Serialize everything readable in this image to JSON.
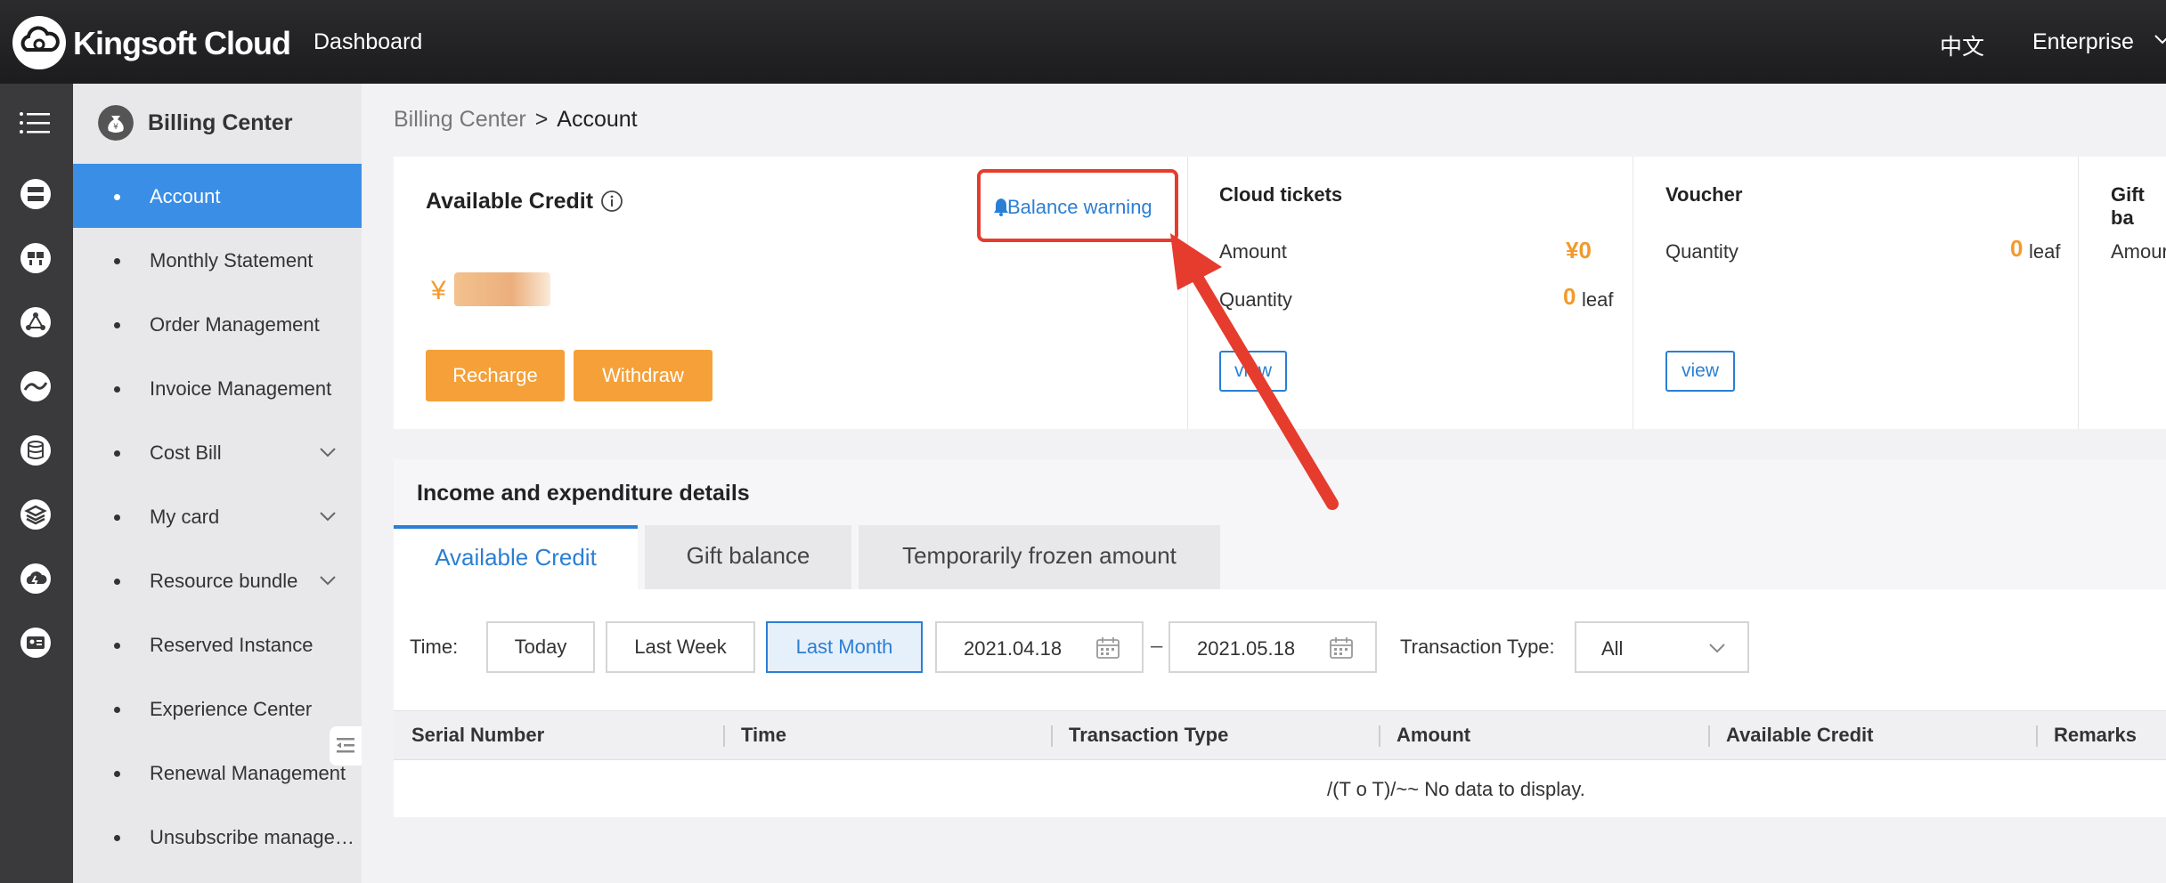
{
  "header": {
    "brand": "Kingsoft Cloud",
    "nav_dashboard": "Dashboard",
    "language": "中文",
    "account_menu": "Enterprise"
  },
  "rail": {
    "icons": [
      "menu-icon",
      "server-icon",
      "network-icon",
      "topology-icon",
      "analytics-icon",
      "database-icon",
      "storage-icon",
      "cloud-icon",
      "identity-icon"
    ]
  },
  "sidebar": {
    "title": "Billing Center",
    "items": [
      {
        "label": "Account",
        "active": true,
        "expandable": false
      },
      {
        "label": "Monthly Statement",
        "active": false,
        "expandable": false
      },
      {
        "label": "Order Management",
        "active": false,
        "expandable": false
      },
      {
        "label": "Invoice Management",
        "active": false,
        "expandable": false
      },
      {
        "label": "Cost Bill",
        "active": false,
        "expandable": true
      },
      {
        "label": "My card",
        "active": false,
        "expandable": true
      },
      {
        "label": "Resource bundle",
        "active": false,
        "expandable": true
      },
      {
        "label": "Reserved Instance",
        "active": false,
        "expandable": false
      },
      {
        "label": "Experience Center",
        "active": false,
        "expandable": false
      },
      {
        "label": "Renewal Management",
        "active": false,
        "expandable": false
      },
      {
        "label": "Unsubscribe manage…",
        "active": false,
        "expandable": false
      }
    ]
  },
  "breadcrumb": {
    "parent": "Billing Center",
    "separator": ">",
    "current": "Account"
  },
  "available_credit": {
    "title": "Available Credit",
    "balance_warning": "Balance warning",
    "currency": "¥",
    "recharge": "Recharge",
    "withdraw": "Withdraw"
  },
  "cloud_tickets": {
    "title": "Cloud tickets",
    "amount_label": "Amount",
    "amount_value": "¥0",
    "quantity_label": "Quantity",
    "quantity_value": "0",
    "quantity_unit": "leaf",
    "view": "view"
  },
  "voucher": {
    "title": "Voucher",
    "quantity_label": "Quantity",
    "quantity_value": "0",
    "quantity_unit": "leaf",
    "view": "view"
  },
  "gift_balance": {
    "title": "Gift ba",
    "amount_label": "Amour"
  },
  "details": {
    "title": "Income and expenditure details",
    "tabs": [
      "Available Credit",
      "Gift balance",
      "Temporarily frozen amount"
    ],
    "active_tab": "Available Credit",
    "time_label": "Time:",
    "time_buttons": [
      "Today",
      "Last Week",
      "Last Month"
    ],
    "selected_time": "Last Month",
    "date_from": "2021.04.18",
    "date_sep": "–",
    "date_to": "2021.05.18",
    "transaction_type_label": "Transaction Type:",
    "transaction_type_value": "All",
    "columns": [
      "Serial Number",
      "Time",
      "Transaction Type",
      "Amount",
      "Available Credit",
      "Remarks"
    ],
    "empty_message": "/(T o T)/~~ No data to display."
  },
  "colors": {
    "accent_blue": "#2a7fd4",
    "sidebar_active": "#3a8ee6",
    "orange": "#f5a038",
    "annotation_red": "#e53c2e"
  }
}
